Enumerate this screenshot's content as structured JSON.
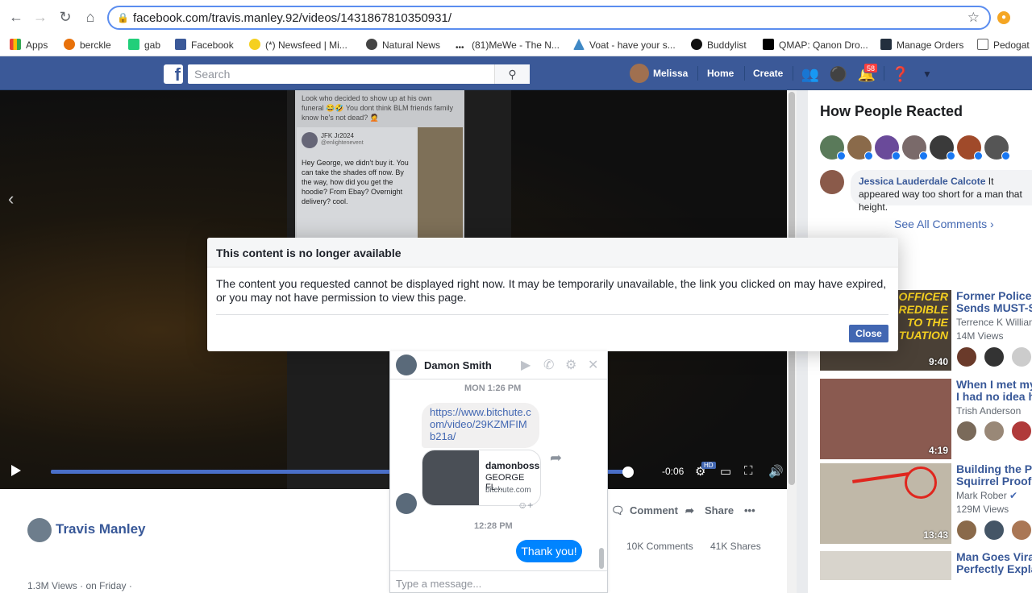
{
  "browser": {
    "url": "facebook.com/travis.manley.92/videos/1431867810350931/",
    "bookmarks": [
      "Apps",
      "berckle",
      "gab",
      "Facebook",
      "(*) Newsfeed | Mi...",
      "Natural News",
      "(81)MeWe - The N...",
      "Voat - have your s...",
      "Buddylist",
      "QMAP: Qanon Dro...",
      "Manage Orders",
      "Pedogat"
    ]
  },
  "fb_header": {
    "logo": "f",
    "search_placeholder": "Search",
    "user": "Melissa",
    "home": "Home",
    "create": "Create",
    "notifications": "58"
  },
  "video": {
    "post_text": "Look who decided to show up at his own funeral 😂🤣 You dont think BLM friends family know he's not dead? 🤦",
    "reply_author": "JFK Jr2024",
    "reply_handle": "@enlightenevent",
    "reply_text": "Hey George, we didn't buy it. You can take the shades off now. By the way, how did you get the hoodie? From Ebay? Overnight delivery? cool.",
    "time": "-0:06",
    "hd": "HD",
    "progress": 0.95
  },
  "post": {
    "author": "Travis Manley",
    "views": "1.3M Views · on Friday · ",
    "comment_label": "Comment",
    "share_label": "Share",
    "comments_count": "10K Comments",
    "shares_count": "41K Shares"
  },
  "right_panel": {
    "title": "How People Reacted",
    "comment": {
      "name": "Jessica Lauderdale Calcote",
      "text": " It appeared way too short for a man that height."
    },
    "see_all": "See All Comments",
    "videos": [
      {
        "title": "Former Police O",
        "title2": "Sends MUST-S",
        "author": "Terrence K Willian",
        "views": "14M Views",
        "duration": "9:40",
        "thumb_text": "E OFFICER REDIBLE TO THE TUATION"
      },
      {
        "title": "When I met my",
        "title2": "I had no idea h",
        "author": "Trish Anderson",
        "views": "",
        "duration": "4:19",
        "thumb_text": ""
      },
      {
        "title": "Building the Pe",
        "title2": "Squirrel Proof",
        "author": "Mark Rober",
        "views": "129M Views",
        "duration": "13:43",
        "thumb_text": ""
      },
      {
        "title": "Man Goes Vira",
        "title2": "Perfectly Expla",
        "author": "",
        "views": "",
        "duration": "",
        "thumb_text": ""
      }
    ]
  },
  "modal": {
    "title": "This content is no longer available",
    "body": "The content you requested cannot be displayed right now. It may be temporarily unavailable, the link you clicked on may have expired, or you may not have permission to view this page.",
    "close": "Close"
  },
  "chat": {
    "name": "Damon Smith",
    "ts1": "MON 1:26 PM",
    "link_text": "https://www.bitchute.com/video/29KZMFIMb21a/",
    "link_title": "damonboss",
    "link_desc": "GEORGE FL...",
    "link_src": "bitchute.com",
    "ts2": "12:28 PM",
    "my_msg": "Thank you!",
    "input_placeholder": "Type a message..."
  }
}
